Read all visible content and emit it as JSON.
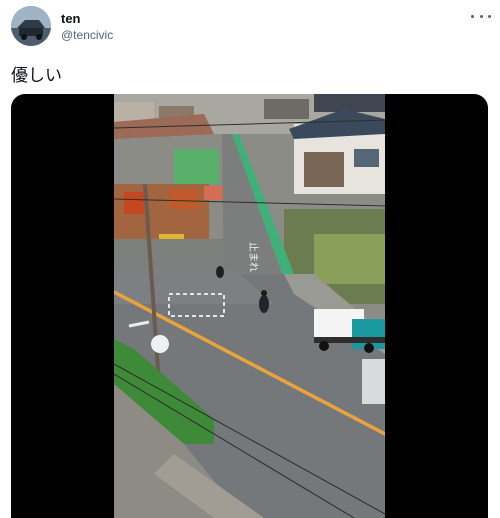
{
  "author": {
    "name": "ten",
    "handle": "@tencivic"
  },
  "tweet": {
    "text": "優しい"
  },
  "media": {
    "type": "video",
    "road_marking_text": "止まれ"
  },
  "colors": {
    "name": "#0f1419",
    "handle": "#536471",
    "media_background": "#000000",
    "bike_lane": "#3fb078",
    "center_line": "#e8a33c"
  }
}
